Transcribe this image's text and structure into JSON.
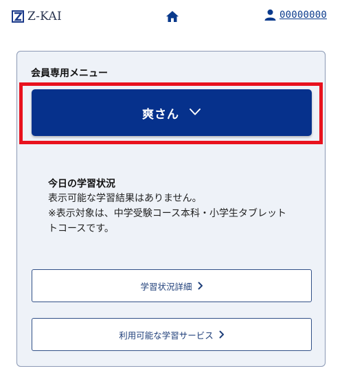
{
  "header": {
    "logo_text": "Z-KAI",
    "user_id": "00000000",
    "icons": {
      "logo": "z-kai-logo-mark",
      "home": "home-icon",
      "user": "user-icon"
    }
  },
  "panel": {
    "menu_label": "会員専用メニュー",
    "member_button_label": "爽さん",
    "status": {
      "title": "今日の学習状況",
      "lines": [
        "表示可能な学習結果はありません。",
        "※表示対象は、中学受験コース本科・小学生タブレット",
        "トコースです。"
      ]
    },
    "links": [
      {
        "label": "学習状況詳細"
      },
      {
        "label": "利用可能な学習サービス"
      }
    ]
  },
  "colors": {
    "primary": "#06318c",
    "highlight": "#e8121e",
    "panel_bg": "#eef2f8",
    "link_text": "#1f3f7a"
  }
}
